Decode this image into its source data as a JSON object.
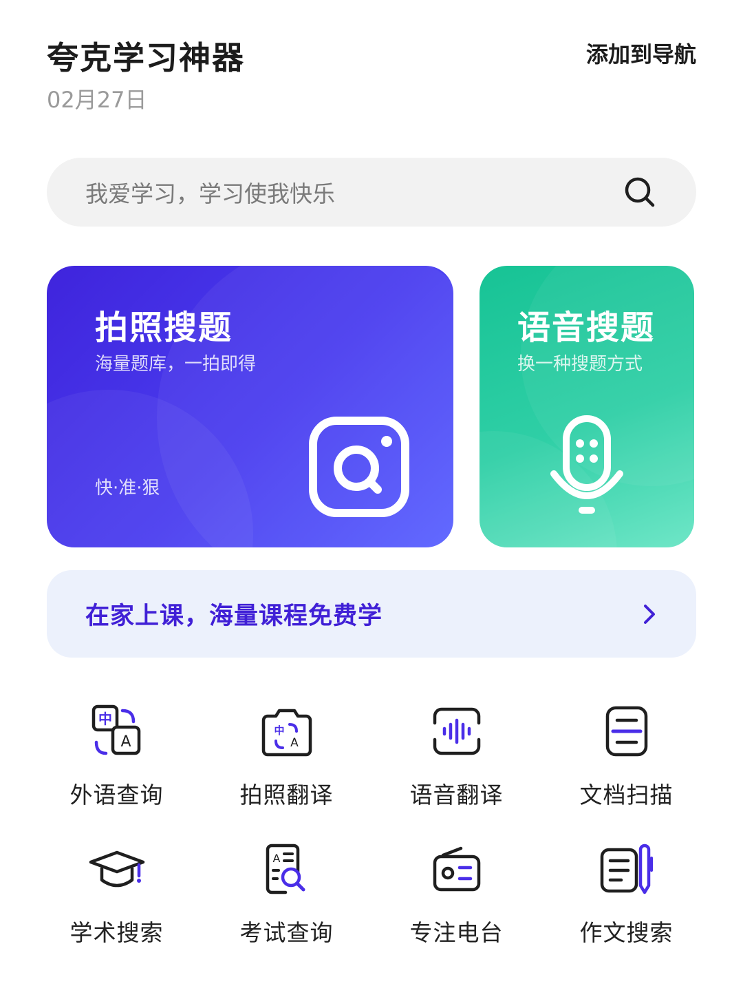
{
  "header": {
    "title": "夸克学习神器",
    "date": "02月27日",
    "add_nav_label": "添加到导航"
  },
  "search": {
    "placeholder": "我爱学习，学习使我快乐"
  },
  "cards": {
    "photo": {
      "title": "拍照搜题",
      "subtitle": "海量题库，一拍即得",
      "tag": "快·准·狠",
      "icon": "camera-search-icon",
      "color": "#4330e6"
    },
    "voice": {
      "title": "语音搜题",
      "subtitle": "换一种搜题方式",
      "icon": "microphone-icon",
      "color": "#1fc79c"
    }
  },
  "banner": {
    "text": "在家上课，海量课程免费学",
    "color": "#4020d6"
  },
  "tools": [
    {
      "label": "外语查询",
      "icon": "translate-card-icon"
    },
    {
      "label": "拍照翻译",
      "icon": "camera-translate-icon"
    },
    {
      "label": "语音翻译",
      "icon": "voice-wave-icon"
    },
    {
      "label": "文档扫描",
      "icon": "document-scan-icon"
    },
    {
      "label": "学术搜索",
      "icon": "graduation-cap-icon"
    },
    {
      "label": "考试查询",
      "icon": "exam-search-icon"
    },
    {
      "label": "专注电台",
      "icon": "radio-icon"
    },
    {
      "label": "作文搜索",
      "icon": "essay-pen-icon"
    }
  ],
  "colors": {
    "accent": "#4a2ee8",
    "icon_stroke": "#1f1f1f"
  }
}
